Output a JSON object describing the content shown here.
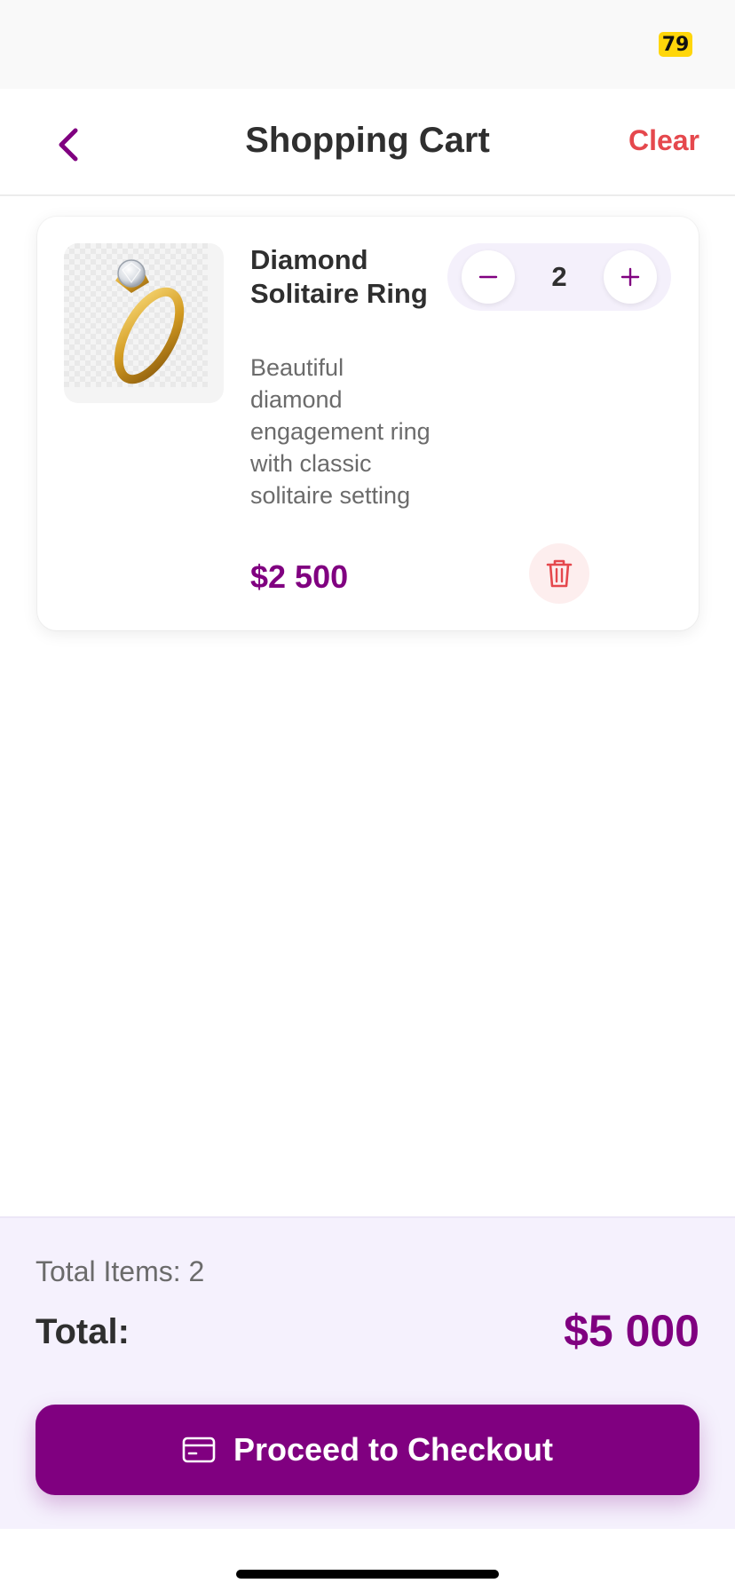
{
  "status_bar": {
    "battery": "79"
  },
  "header": {
    "title": "Shopping Cart",
    "clear_label": "Clear"
  },
  "cart": {
    "items": [
      {
        "name": "Diamond Solitaire Ring",
        "description": "Beautiful diamond engagement ring with classic solitaire setting",
        "price": "$2 500",
        "quantity": "2"
      }
    ]
  },
  "summary": {
    "total_items": "Total Items: 2",
    "total_label": "Total:",
    "total_value": "$5 000",
    "checkout_label": "Proceed to Checkout"
  },
  "colors": {
    "accent": "#800080",
    "danger": "#e5484d",
    "summary_bg": "#f5f1fd"
  },
  "icons": {
    "back": "chevron-left-icon",
    "minus": "minus-icon",
    "plus": "plus-icon",
    "delete": "trash-icon",
    "checkout": "credit-card-icon"
  }
}
